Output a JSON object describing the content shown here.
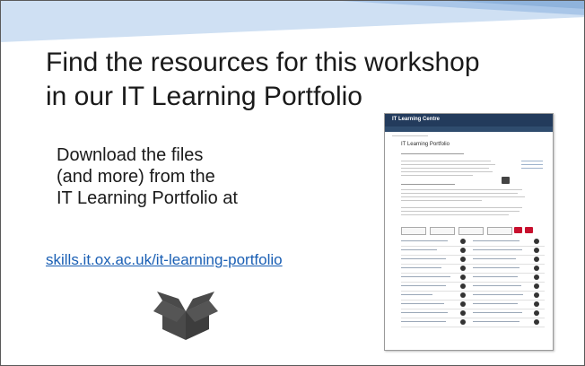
{
  "slide": {
    "title_line1": "Find the resources for this workshop",
    "title_line2": "in our IT Learning Portfolio",
    "body_line1": "Download the files",
    "body_line2": "(and more) from the",
    "body_line3": "IT Learning Portfolio at",
    "link_text": "skills.it.ox.ac.uk/it-learning-portfolio",
    "icon": "open-box-icon"
  },
  "thumbnail": {
    "header_title": "IT Learning Centre",
    "page_heading": "IT Learning Portfolio"
  },
  "colors": {
    "banner_light": "#cfe0f3",
    "banner_mid": "#8fb3dc",
    "link": "#1a5fb4",
    "icon": "#4a4a4a",
    "thumb_header": "#233b5c",
    "thumb_button": "#c8102e"
  }
}
